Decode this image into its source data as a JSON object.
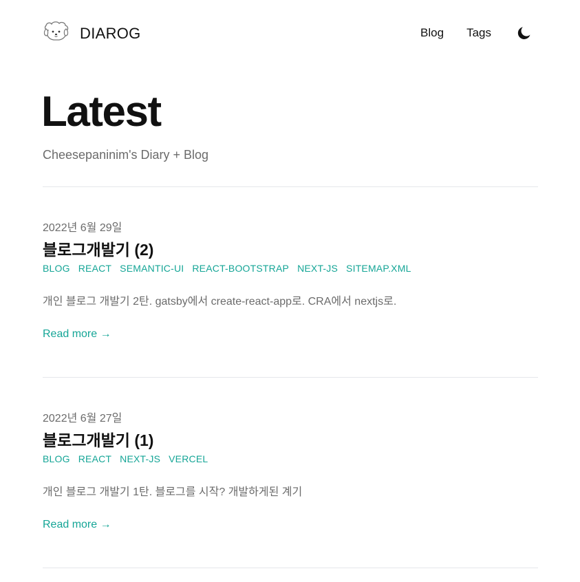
{
  "header": {
    "brand": "DIAROG",
    "logo_icon": "puppy-face-icon",
    "nav": [
      {
        "label": "Blog"
      },
      {
        "label": "Tags"
      }
    ],
    "theme_toggle_icon": "moon-icon"
  },
  "hero": {
    "title": "Latest",
    "subtitle": "Cheesepaninim's Diary + Blog"
  },
  "posts": [
    {
      "date": "2022년 6월 29일",
      "title": "블로그개발기 (2)",
      "tags": [
        "BLOG",
        "REACT",
        "SEMANTIC-UI",
        "REACT-BOOTSTRAP",
        "NEXT-JS",
        "SITEMAP.XML"
      ],
      "summary": "개인 블로그 개발기 2탄. gatsby에서 create-react-app로. CRA에서 nextjs로.",
      "read_more": "Read more →"
    },
    {
      "date": "2022년 6월 27일",
      "title": "블로그개발기 (1)",
      "tags": [
        "BLOG",
        "REACT",
        "NEXT-JS",
        "VERCEL"
      ],
      "summary": "개인 블로그 개발기 1탄. 블로그를 시작? 개발하게된 계기",
      "read_more": "Read more →"
    }
  ],
  "colors": {
    "accent": "#14a596",
    "highlight": "#fcff5e",
    "muted_text": "#6b6b6b",
    "divider": "#e5e7eb"
  }
}
